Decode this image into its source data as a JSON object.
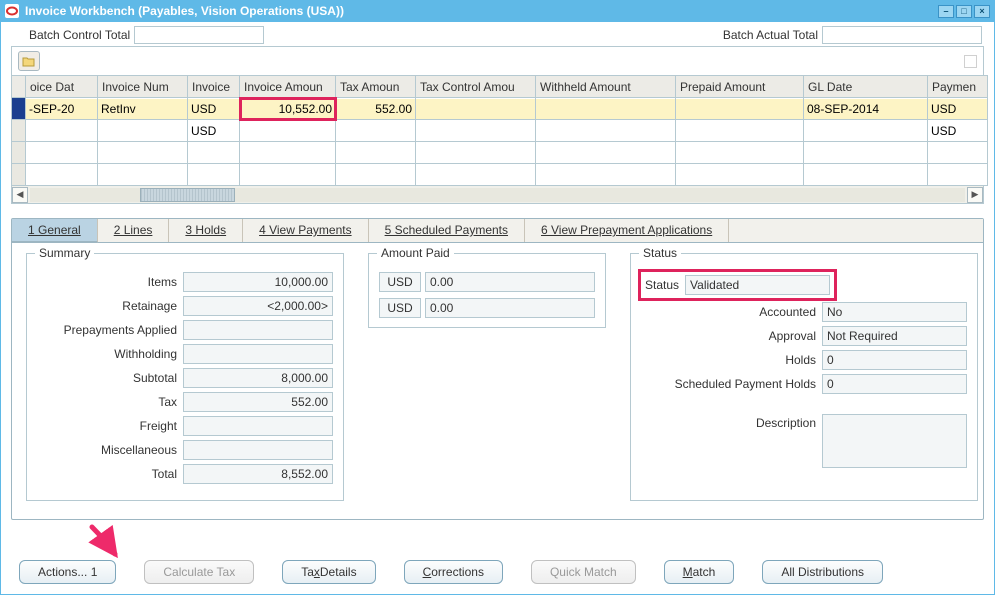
{
  "window": {
    "title": "Invoice Workbench (Payables, Vision Operations (USA))"
  },
  "batch": {
    "control_label": "Batch Control Total",
    "control_value": "",
    "actual_label": "Batch Actual Total",
    "actual_value": ""
  },
  "grid": {
    "headers": [
      "oice Dat",
      "Invoice Num",
      "Invoice",
      "Invoice Amoun",
      "Tax Amoun",
      "Tax Control Amou",
      "Withheld Amount",
      "Prepaid Amount",
      "GL Date",
      "Paymen"
    ],
    "rows": [
      {
        "selected": true,
        "cells": [
          "-SEP-20",
          "RetInv",
          "USD",
          "10,552.00",
          "552.00",
          "",
          "",
          "",
          "08-SEP-2014",
          "USD"
        ]
      },
      {
        "selected": false,
        "cells": [
          "",
          "",
          "USD",
          "",
          "",
          "",
          "",
          "",
          "",
          "USD"
        ]
      },
      {
        "selected": false,
        "cells": [
          "",
          "",
          "",
          "",
          "",
          "",
          "",
          "",
          "",
          ""
        ]
      },
      {
        "selected": false,
        "cells": [
          "",
          "",
          "",
          "",
          "",
          "",
          "",
          "",
          "",
          ""
        ]
      }
    ]
  },
  "tabs": {
    "general": "1 General",
    "lines": "2 Lines",
    "holds": "3 Holds",
    "view_payments": "4 View Payments",
    "scheduled": "5 Scheduled Payments",
    "prepay": "6 View Prepayment Applications"
  },
  "summary": {
    "legend": "Summary",
    "items_label": "Items",
    "items": "10,000.00",
    "retainage_label": "Retainage",
    "retainage": "<2,000.00>",
    "prepay_label": "Prepayments Applied",
    "prepay": "",
    "withholding_label": "Withholding",
    "withholding": "",
    "subtotal_label": "Subtotal",
    "subtotal": "8,000.00",
    "tax_label": "Tax",
    "tax": "552.00",
    "freight_label": "Freight",
    "freight": "",
    "misc_label": "Miscellaneous",
    "misc": "",
    "total_label": "Total",
    "total": "8,552.00"
  },
  "amount_paid": {
    "legend": "Amount Paid",
    "row1_cur": "USD",
    "row1_amt": "0.00",
    "row2_cur": "USD",
    "row2_amt": "0.00"
  },
  "status": {
    "legend": "Status",
    "status_label": "Status",
    "status_value": "Validated",
    "accounted_label": "Accounted",
    "accounted_value": "No",
    "approval_label": "Approval",
    "approval_value": "Not Required",
    "holds_label": "Holds",
    "holds_value": "0",
    "sched_holds_label": "Scheduled Payment Holds",
    "sched_holds_value": "0",
    "description_label": "Description",
    "description_value": ""
  },
  "buttons": {
    "actions": "Actions... 1",
    "calc_tax": "Calculate Tax",
    "tax_details": "Tax Details",
    "corrections": "Corrections",
    "quick_match": "Quick Match",
    "match": "Match",
    "all_dist": "All Distributions"
  }
}
